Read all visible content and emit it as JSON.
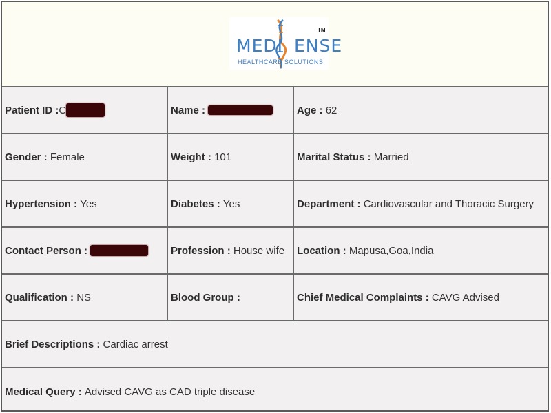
{
  "logo": {
    "brand_left": "MEDI",
    "brand_right": "ENSE",
    "tm": "TM",
    "tagline": "HEALTHCARE SOLUTIONS"
  },
  "fields": {
    "patient_id": {
      "label": "Patient ID",
      "value": "C"
    },
    "name": {
      "label": "Name",
      "value": ""
    },
    "age": {
      "label": "Age",
      "value": "62"
    },
    "gender": {
      "label": "Gender",
      "value": "Female"
    },
    "weight": {
      "label": "Weight",
      "value": "101"
    },
    "marital_status": {
      "label": "Marital Status",
      "value": "Married"
    },
    "hypertension": {
      "label": "Hypertension",
      "value": "Yes"
    },
    "diabetes": {
      "label": "Diabetes",
      "value": "Yes"
    },
    "department": {
      "label": "Department",
      "value": "Cardiovascular and Thoracic Surgery"
    },
    "contact_person": {
      "label": "Contact Person",
      "value": ""
    },
    "profession": {
      "label": "Profession",
      "value": "House wife"
    },
    "location": {
      "label": "Location",
      "value": "Mapusa,Goa,India"
    },
    "qualification": {
      "label": "Qualification",
      "value": "NS"
    },
    "blood_group": {
      "label": "Blood Group",
      "value": ""
    },
    "chief_complaints": {
      "label": "Chief Medical Complaints",
      "value": "CAVG Advised"
    },
    "brief_descriptions": {
      "label": "Brief Descriptions",
      "value": "Cardiac arrest"
    },
    "medical_query": {
      "label": "Medical Query",
      "value": "Advised CAVG as CAD triple disease"
    }
  },
  "colors": {
    "brand_blue": "#3d7fc4",
    "helix_orange": "#e8852b",
    "redaction": "#3a0608",
    "border": "#6a6a6a"
  }
}
